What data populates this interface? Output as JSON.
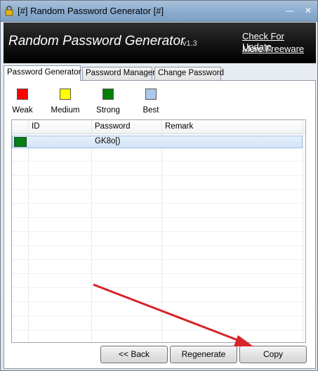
{
  "window": {
    "title": "[#] Random Password Generator [#]",
    "minimize_glyph": "—",
    "close_glyph": "✕"
  },
  "header": {
    "app_title": "Random Password Generator",
    "version": "v1.3",
    "check_update": "Check For Update",
    "more_freeware": "More Freeware"
  },
  "tabs": [
    {
      "label": "Password Generator",
      "active": true
    },
    {
      "label": "Password Manager",
      "active": false
    },
    {
      "label": "Change Password",
      "active": false
    }
  ],
  "legend": [
    {
      "label": "Weak",
      "color": "#ff0000"
    },
    {
      "label": "Medium",
      "color": "#ffff00"
    },
    {
      "label": "Strong",
      "color": "#008000"
    },
    {
      "label": "Best",
      "color": "#a8c8ec"
    }
  ],
  "grid": {
    "columns": [
      "ID",
      "Password",
      "Remark"
    ],
    "rows": [
      {
        "strength": "Strong",
        "id": "",
        "password": "GK8o[)",
        "remark": ""
      }
    ]
  },
  "buttons": {
    "back": "<< Back",
    "regenerate": "Regenerate",
    "copy": "Copy"
  },
  "annotation": {
    "arrow_color": "#d8232a"
  }
}
